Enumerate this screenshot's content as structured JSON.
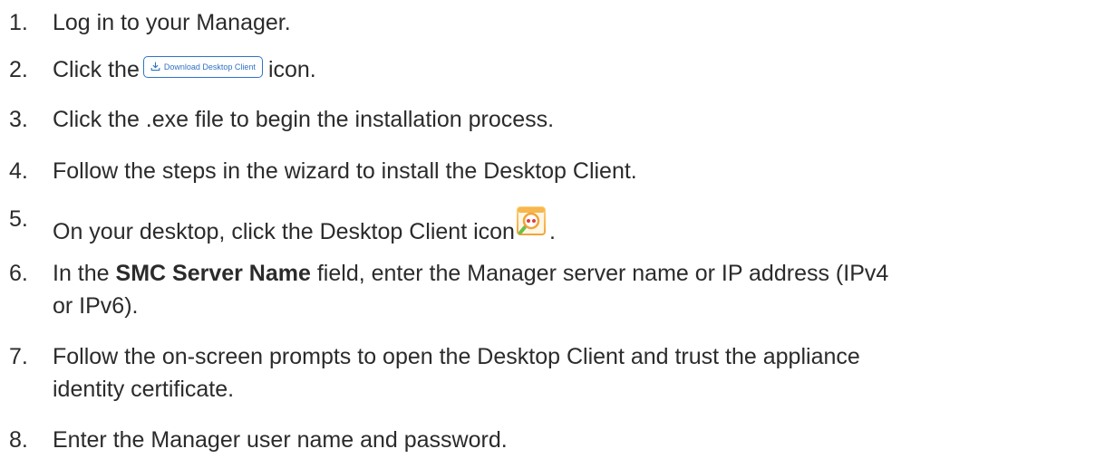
{
  "steps": [
    {
      "num": "1.",
      "text": "Log in to your Manager."
    },
    {
      "num": "2.",
      "before": "Click the",
      "after": "icon."
    },
    {
      "num": "3.",
      "text": "Click the .exe file to begin the installation process."
    },
    {
      "num": "4.",
      "text": "Follow the steps in the wizard to install the Desktop Client."
    },
    {
      "num": "5.",
      "before": "On your desktop, click the Desktop Client icon",
      "after": "."
    },
    {
      "num": "6.",
      "before": "In the",
      "bold": "SMC Server Name",
      "after": "field, enter the Manager server name or IP address (IPv4",
      "line2": "or IPv6)."
    },
    {
      "num": "7.",
      "text": "Follow the on-screen prompts to open the Desktop Client and trust the appliance",
      "line2": "identity certificate."
    },
    {
      "num": "8.",
      "text": "Enter the Manager user name and password."
    }
  ],
  "download_button": {
    "label": "Download Desktop Client",
    "icon": "download-tray-icon",
    "color": "#2f73c6"
  },
  "desktop_client_icon": {
    "icon": "desktop-client-app-icon",
    "colors": {
      "frame": "#f2a43a",
      "magnifier": "#e03b3b",
      "handle": "#6bbf4a"
    }
  }
}
